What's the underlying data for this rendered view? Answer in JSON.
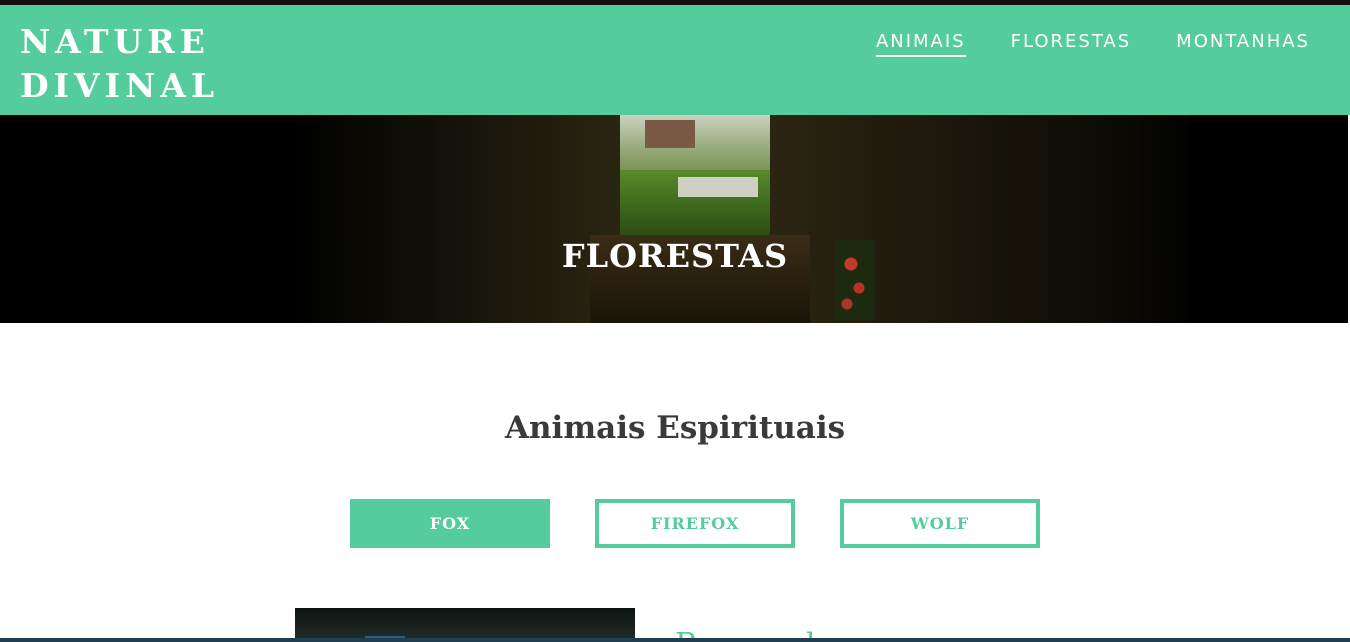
{
  "header": {
    "brand_line1": "NATURE",
    "brand_line2": "DIVINAL",
    "background_color": "#55cc9c",
    "nav": [
      {
        "label": "ANIMAIS",
        "active": true
      },
      {
        "label": "FLORESTAS",
        "active": false
      },
      {
        "label": "MONTANHAS",
        "active": false
      }
    ]
  },
  "hero": {
    "title": "FLORESTAS"
  },
  "section": {
    "title": "Animais Espirituais",
    "tabs": [
      {
        "label": "FOX",
        "active": true
      },
      {
        "label": "FIREFOX",
        "active": false
      },
      {
        "label": "WOLF",
        "active": false
      }
    ]
  },
  "card": {
    "heading": "Raposa de"
  },
  "colors": {
    "accent": "#55cc9c",
    "text_dark": "#3a3a3a",
    "white": "#ffffff"
  }
}
